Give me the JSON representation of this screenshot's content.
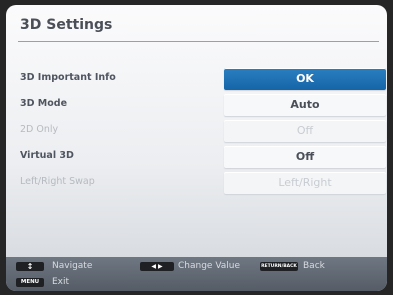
{
  "title": "3D Settings",
  "rows": [
    {
      "label": "3D Important Info",
      "value": "OK",
      "state": "selected"
    },
    {
      "label": "3D Mode",
      "value": "Auto",
      "state": "normal"
    },
    {
      "label": "2D Only",
      "value": "Off",
      "state": "disabled"
    },
    {
      "label": "Virtual 3D",
      "value": "Off",
      "state": "normal"
    },
    {
      "label": "Left/Right Swap",
      "value": "Left/Right",
      "state": "disabled"
    }
  ],
  "footer": {
    "navigate": {
      "key": "↕",
      "label": "Navigate"
    },
    "change": {
      "key": "◀ ▶",
      "label": "Change Value"
    },
    "back": {
      "key": "RETURN/BACK",
      "label": "Back"
    },
    "exit": {
      "key": "MENU",
      "label": "Exit"
    }
  },
  "colors": {
    "selected": "#1a6fb4",
    "footer": "#626a75"
  }
}
